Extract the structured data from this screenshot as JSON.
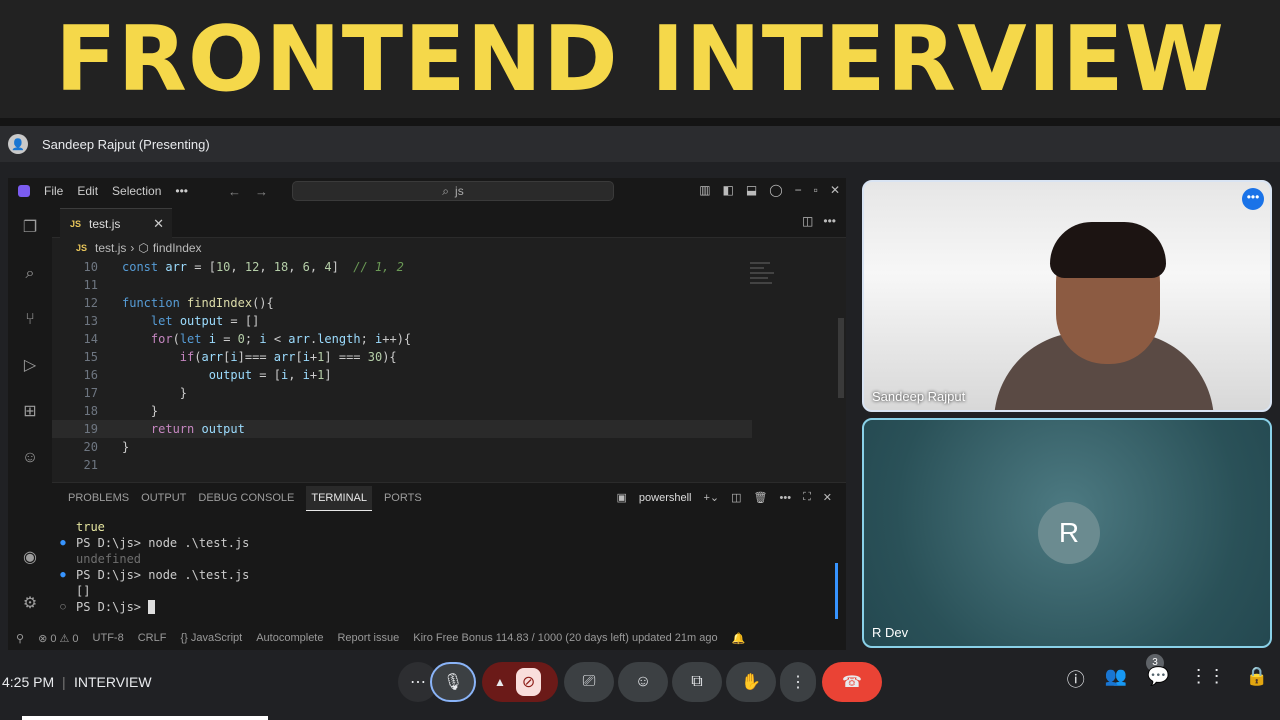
{
  "banner": {
    "title": "FRONTEND INTERVIEW"
  },
  "presenter": {
    "name": "Sandeep Rajput (Presenting)"
  },
  "vscode": {
    "menu": [
      "File",
      "Edit",
      "Selection",
      "•••"
    ],
    "search": "js",
    "tab_label": "test.js",
    "tab_lang": "JS",
    "breadcrumb_file": "test.js",
    "breadcrumb_symbol": "findIndex",
    "code_lines": [
      {
        "n": "10",
        "t": "const arr = [10, 12, 18, 6, 4]  // 1, 2"
      },
      {
        "n": "11",
        "t": ""
      },
      {
        "n": "12",
        "t": "function findIndex(){"
      },
      {
        "n": "13",
        "t": "    let output = []"
      },
      {
        "n": "14",
        "t": "    for(let i = 0; i < arr.length; i++){"
      },
      {
        "n": "15",
        "t": "        if(arr[i]=== arr[i+1] === 30){"
      },
      {
        "n": "16",
        "t": "            output = [i, i+1]"
      },
      {
        "n": "17",
        "t": "        }"
      },
      {
        "n": "18",
        "t": "    }"
      },
      {
        "n": "19",
        "t": "    return output"
      },
      {
        "n": "20",
        "t": "}"
      },
      {
        "n": "21",
        "t": ""
      }
    ],
    "panel_tabs": [
      "PROBLEMS",
      "OUTPUT",
      "DEBUG CONSOLE",
      "TERMINAL",
      "PORTS"
    ],
    "shell": "powershell",
    "terminal_lines": [
      {
        "dot": "",
        "t": "true"
      },
      {
        "dot": "●",
        "t": "PS D:\\js> node .\\test.js"
      },
      {
        "dot": "",
        "t": "undefined"
      },
      {
        "dot": "●",
        "t": "PS D:\\js> node .\\test.js"
      },
      {
        "dot": "",
        "t": "[]"
      },
      {
        "dot": "○",
        "t": "PS D:\\js> "
      }
    ],
    "status": {
      "errors": "⊗ 0 ⚠ 0",
      "encoding": "UTF-8",
      "eol": "CRLF",
      "language": "{} JavaScript",
      "autocomplete": "Autocomplete",
      "report": "Report issue",
      "kiro": "Kiro Free Bonus 114.83 / 1000 (20 days left) updated 21m ago"
    }
  },
  "tiles": {
    "main_name": "Sandeep Rajput",
    "other_name": "R Dev",
    "other_initial": "R"
  },
  "meet": {
    "time": "4:25 PM",
    "separator": "|",
    "meeting": "INTERVIEW",
    "people_count": "3"
  }
}
